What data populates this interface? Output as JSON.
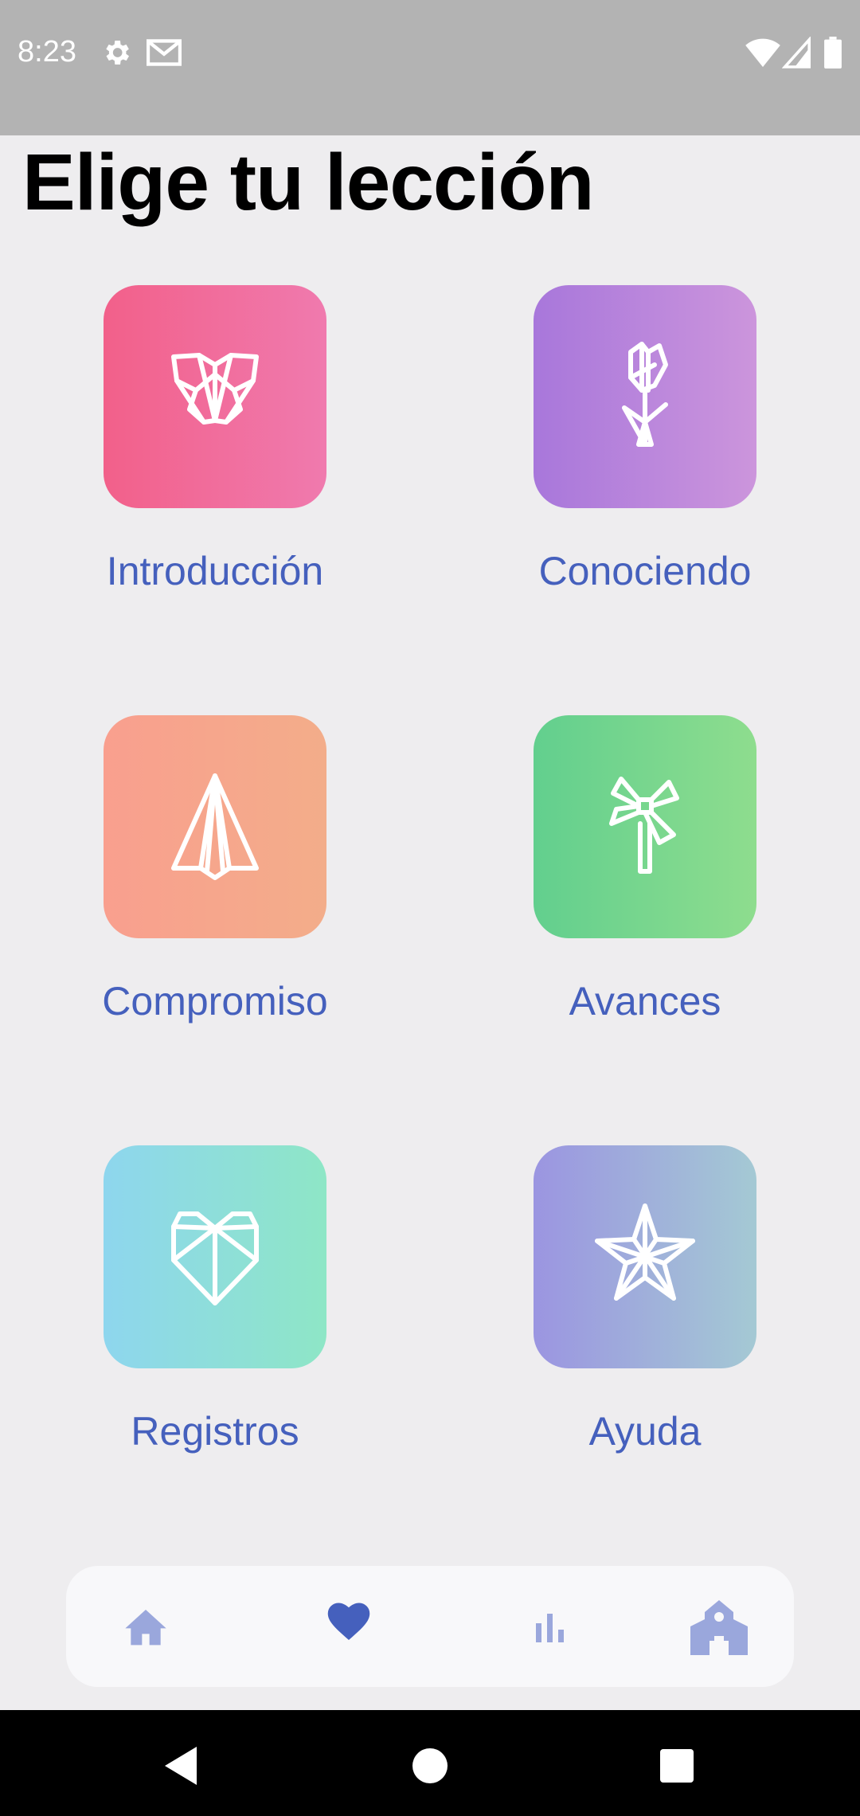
{
  "status_bar": {
    "time": "8:23",
    "icons": [
      "gear-icon",
      "gmail-icon",
      "wifi-icon",
      "signal-icon",
      "battery-icon"
    ],
    "background": "#b3b3b3"
  },
  "page_title": "Elige tu lección",
  "lessons": [
    {
      "label": "Introducción",
      "icon": "origami-butterfly-icon",
      "gradient": [
        "#f2608a",
        "#f07aae"
      ]
    },
    {
      "label": "Conociendo",
      "icon": "origami-tulip-icon",
      "gradient": [
        "#a877db",
        "#cc95dc"
      ]
    },
    {
      "label": "Compromiso",
      "icon": "paper-plane-icon",
      "gradient": [
        "#f99f8e",
        "#f3ad8a"
      ]
    },
    {
      "label": "Avances",
      "icon": "pinwheel-icon",
      "gradient": [
        "#62cf8e",
        "#8edd8e"
      ]
    },
    {
      "label": "Registros",
      "icon": "origami-heart-icon",
      "gradient": [
        "#8ed6ee",
        "#8ee6c6"
      ]
    },
    {
      "label": "Ayuda",
      "icon": "origami-star-icon",
      "gradient": [
        "#9b95e1",
        "#a4c9d4"
      ]
    }
  ],
  "label_color": "#4560bd",
  "bottom_nav": {
    "items": [
      "home-icon",
      "heart-icon",
      "bar-chart-icon",
      "school-icon"
    ],
    "active": "heart-icon",
    "active_color": "#4560bd",
    "inactive_color": "#9aa7dc"
  },
  "system_nav": [
    "back-icon",
    "home-circle-icon",
    "recents-icon"
  ]
}
